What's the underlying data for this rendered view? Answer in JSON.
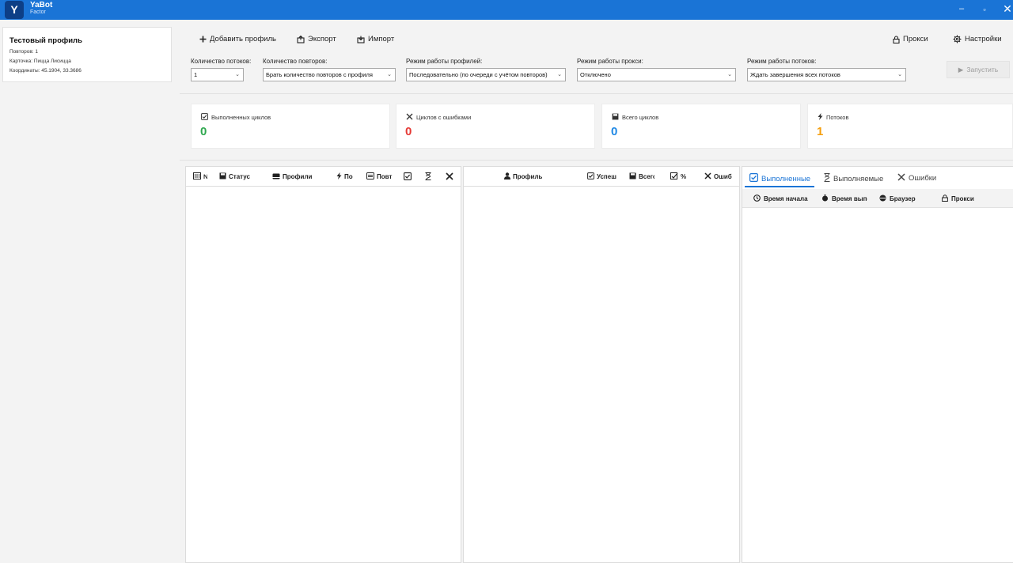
{
  "titlebar": {
    "logo_letter": "Y",
    "app_name": "YaBot",
    "app_sub": "Factor",
    "min_glyph": "–",
    "max_glyph": "▫",
    "close_glyph": "✕"
  },
  "profile": {
    "name": "Тестовый профиль",
    "repeats": "Повторов: 1",
    "card": "Карточка: Пицца Лисицца",
    "coords": "Координаты: 45.1904, 33.3686"
  },
  "toolbar": {
    "add_profile": "Добавить профиль",
    "export": "Экспорт",
    "import": "Импорт",
    "proxy": "Прокси",
    "settings": "Настройки"
  },
  "controls": {
    "threads_label": "Количество потоков:",
    "threads_value": "1",
    "repeats_label": "Количество повторов:",
    "repeats_value": "Брать количество повторов с профиля",
    "profile_mode_label": "Режим работы профилей:",
    "profile_mode_value": "Последовательно (по очереди с учётом повторов)",
    "proxy_mode_label": "Режим работы прокси:",
    "proxy_mode_value": "Отключено",
    "thread_mode_label": "Режим работы потоков:",
    "thread_mode_value": "Ждать завершения всех потоков",
    "run_label": "Запустить"
  },
  "stats": [
    {
      "title": "Выполненных циклов",
      "value": "0",
      "color": "#2fa84f",
      "icon": "check-square-icon"
    },
    {
      "title": "Циклов с ошибками",
      "value": "0",
      "color": "#e53935",
      "icon": "x-icon"
    },
    {
      "title": "Всего циклов",
      "value": "0",
      "color": "#1e88e5",
      "icon": "save-icon"
    },
    {
      "title": "Потоков",
      "value": "1",
      "color": "#f59e0b",
      "icon": "bolt-icon"
    }
  ],
  "left_table": {
    "columns": [
      "№",
      "Статус",
      "Профили",
      "По",
      "Повт"
    ]
  },
  "mid_table": {
    "columns": [
      "Профиль",
      "Успеш",
      "Всего",
      "%",
      "Ошиб"
    ]
  },
  "right_panel": {
    "tabs": [
      "Выполненные",
      "Выполняемые",
      "Ошибки"
    ],
    "columns": [
      "Время начала",
      "Время выпо",
      "Браузер",
      "Прокси"
    ]
  }
}
